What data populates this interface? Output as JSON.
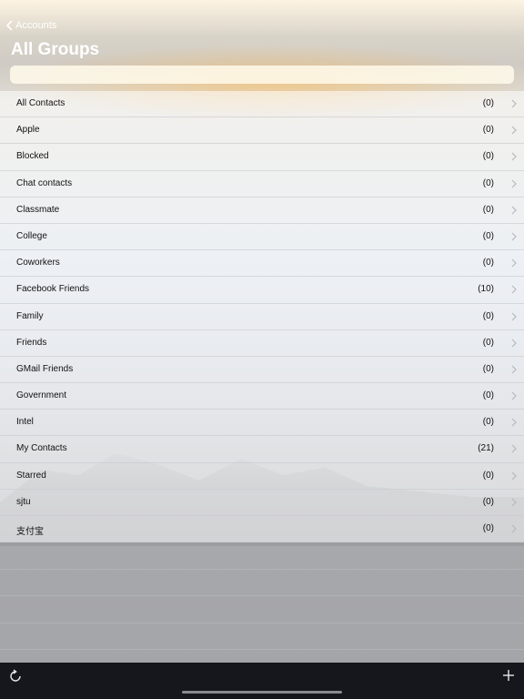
{
  "status_bar": {
    "time": "",
    "right": ""
  },
  "nav": {
    "back_label": "Accounts",
    "title": "All Groups"
  },
  "search": {
    "placeholder": ""
  },
  "groups": [
    {
      "name": "All Contacts",
      "count": "(0)"
    },
    {
      "name": "Apple",
      "count": "(0)"
    },
    {
      "name": "Blocked",
      "count": "(0)"
    },
    {
      "name": "Chat contacts",
      "count": "(0)"
    },
    {
      "name": "Classmate",
      "count": "(0)"
    },
    {
      "name": "College",
      "count": "(0)"
    },
    {
      "name": "Coworkers",
      "count": "(0)"
    },
    {
      "name": "Facebook Friends",
      "count": "(10)"
    },
    {
      "name": "Family",
      "count": "(0)"
    },
    {
      "name": "Friends",
      "count": "(0)"
    },
    {
      "name": "GMail Friends",
      "count": "(0)"
    },
    {
      "name": "Government",
      "count": "(0)"
    },
    {
      "name": "Intel",
      "count": "(0)"
    },
    {
      "name": "My Contacts",
      "count": "(21)"
    },
    {
      "name": "Starred",
      "count": "(0)"
    },
    {
      "name": "sjtu",
      "count": "(0)"
    },
    {
      "name": "支付宝",
      "count": "(0)"
    }
  ],
  "toolbar": {
    "refresh_icon": "refresh-icon",
    "add_icon": "plus-icon"
  },
  "colors": {
    "toolbar_bg": "#15171c",
    "nav_text": "#ffffff",
    "row_text": "#111111"
  }
}
